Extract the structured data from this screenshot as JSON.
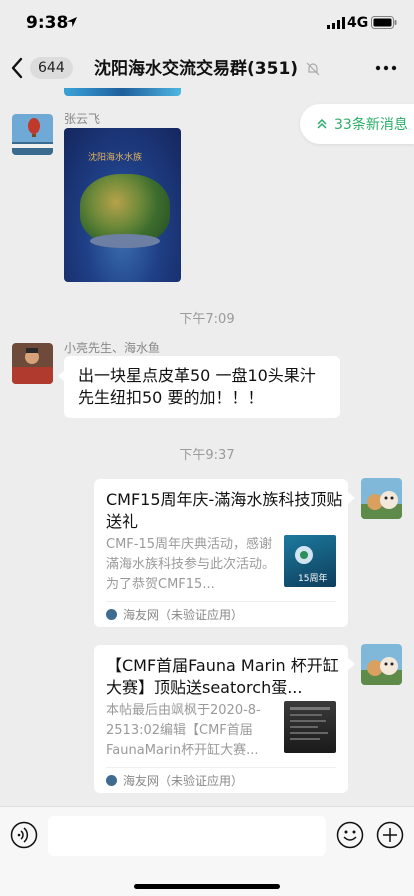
{
  "status_bar": {
    "time": "9:38",
    "network": "4G"
  },
  "nav": {
    "unread_count": "644",
    "title": "沈阳海水交流交易群(351)"
  },
  "new_messages_pill": {
    "label": "33条新消息"
  },
  "messages": {
    "m1": {
      "sender": "张云飞",
      "image_caption": "沈阳海水水族 "
    },
    "t1": "下午7:09",
    "m2": {
      "sender": "小亮先生、海水鱼",
      "text": "出一块星点皮革50 一盘10头果汁先生纽扣50 要的加！！！"
    },
    "t2": "下午9:37",
    "card1": {
      "title": "CMF15周年庆-滿海水族科技顶贴送礼",
      "desc": "CMF-15周年庆典活动，感谢滿海水族科技参与此次活动。为了恭贺CMF15...",
      "source": "海友网（未验证应用）",
      "thumb_text": "15周年"
    },
    "card2": {
      "title": "【CMF首届Fauna Marin 杯开缸大赛】顶贴送seatorch蛋...",
      "desc": "本帖最后由飒枫于2020-8-2513:02编辑【CMF首届FaunaMarin杯开缸大赛...",
      "source": "海友网（未验证应用）"
    }
  },
  "colors": {
    "accent_green": "#2aae67",
    "background": "#ededed",
    "bubble": "#ffffff"
  }
}
